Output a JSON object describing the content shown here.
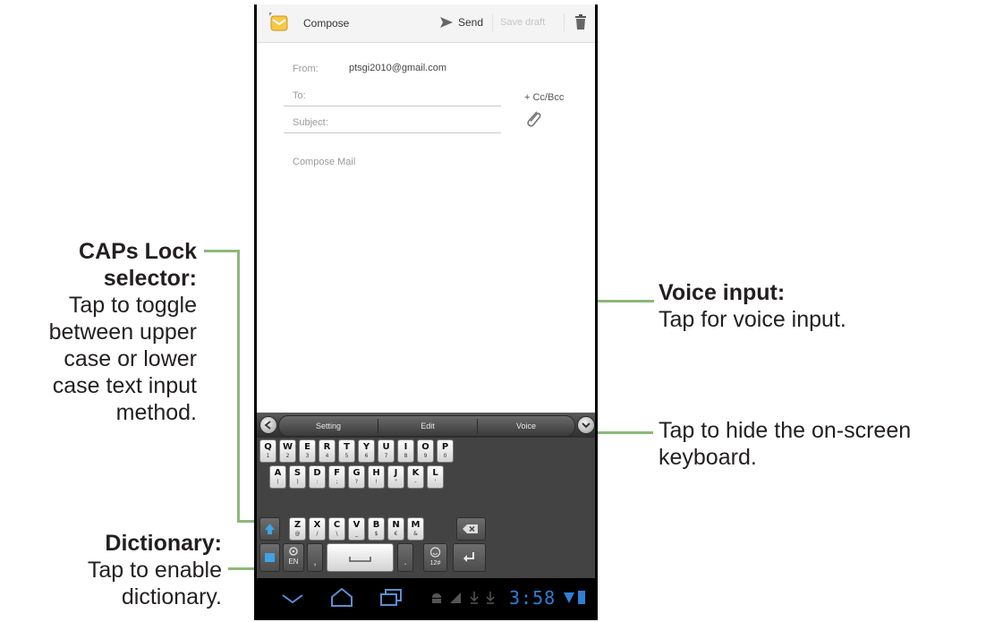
{
  "actionbar": {
    "title": "Compose",
    "send_label": "Send",
    "save_draft_label": "Save draft"
  },
  "compose": {
    "from_label": "From:",
    "from_value": "ptsgi2010@gmail.com",
    "to_label": "To:",
    "cc_bcc_label": "+ Cc/Bcc",
    "subject_label": "Subject:",
    "body_placeholder": "Compose Mail"
  },
  "keyboard": {
    "toolbar": {
      "setting": "Setting",
      "edit": "Edit",
      "voice": "Voice"
    },
    "row1": [
      {
        "m": "Q",
        "s": "1"
      },
      {
        "m": "W",
        "s": "2"
      },
      {
        "m": "E",
        "s": "3"
      },
      {
        "m": "R",
        "s": "4"
      },
      {
        "m": "T",
        "s": "5"
      },
      {
        "m": "Y",
        "s": "6"
      },
      {
        "m": "U",
        "s": "7"
      },
      {
        "m": "I",
        "s": "8"
      },
      {
        "m": "O",
        "s": "9"
      },
      {
        "m": "P",
        "s": "0"
      }
    ],
    "row2": [
      {
        "m": "A",
        "s": "("
      },
      {
        "m": "S",
        "s": ")"
      },
      {
        "m": "D",
        "s": ":"
      },
      {
        "m": "F",
        "s": ";"
      },
      {
        "m": "G",
        "s": "?"
      },
      {
        "m": "H",
        "s": "!"
      },
      {
        "m": "J",
        "s": "\""
      },
      {
        "m": "K",
        "s": "-"
      },
      {
        "m": "L",
        "s": "'"
      }
    ],
    "row3": [
      {
        "m": "Z",
        "s": "@"
      },
      {
        "m": "X",
        "s": "/"
      },
      {
        "m": "C",
        "s": "\\"
      },
      {
        "m": "V",
        "s": "_"
      },
      {
        "m": "B",
        "s": "$"
      },
      {
        "m": "N",
        "s": "€"
      },
      {
        "m": "M",
        "s": "&"
      }
    ],
    "lang_label": "EN",
    "comma": ",",
    "period": ".",
    "numbers_label": "12#"
  },
  "statusbar": {
    "time": "3:58"
  },
  "annotations": {
    "caps_title_1": "CAPs Lock",
    "caps_title_2": "selector:",
    "caps_desc": [
      "Tap to toggle",
      "between upper",
      "case or lower",
      "case text input",
      "method."
    ],
    "dict_title": "Dictionary:",
    "dict_desc": [
      "Tap to enable",
      "dictionary."
    ],
    "voice_title": "Voice input:",
    "voice_desc": "Tap for voice input.",
    "hide_desc": [
      "Tap to hide the on-screen",
      "keyboard."
    ]
  },
  "colors": {
    "callout_line": "#8cb87a",
    "clock": "#2f7fd6",
    "keyboard_bg": "#434343"
  }
}
